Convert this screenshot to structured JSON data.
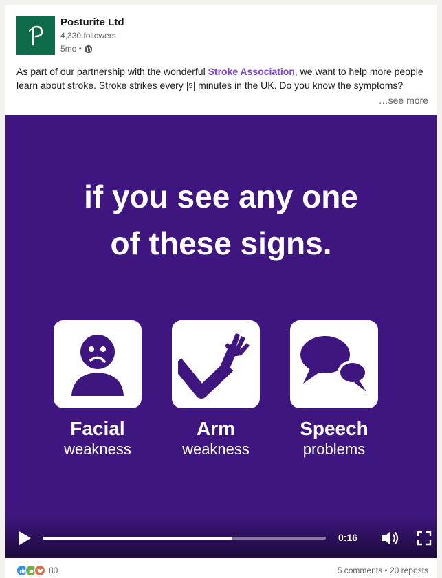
{
  "post": {
    "company": "Posturite Ltd",
    "followers": "4,330 followers",
    "age": "5mo •",
    "text_before": "As part of our partnership with the wonderful ",
    "mention": "Stroke Association",
    "text_mid": ", we want to help more people learn about stroke. Stroke strikes every ",
    "box_number": "5",
    "text_after": " minutes in the UK. Do you know the symptoms?",
    "see_more": "…see more"
  },
  "video": {
    "headline_1": "if you see any one",
    "headline_2": "of these signs.",
    "signs": [
      {
        "title": "Facial",
        "sub": "weakness",
        "icon": "sad-face-icon"
      },
      {
        "title": "Arm",
        "sub": "weakness",
        "icon": "raised-arm-icon"
      },
      {
        "title": "Speech",
        "sub": "problems",
        "icon": "speech-bubbles-icon"
      }
    ],
    "time": "0:16",
    "progress": 0.67
  },
  "footer": {
    "reaction_count": "80",
    "stats": "5 comments • 20 reposts"
  },
  "colors": {
    "video_bg": "#3f1680",
    "brand": "#0d6b4a",
    "mention": "#7b42d8"
  }
}
